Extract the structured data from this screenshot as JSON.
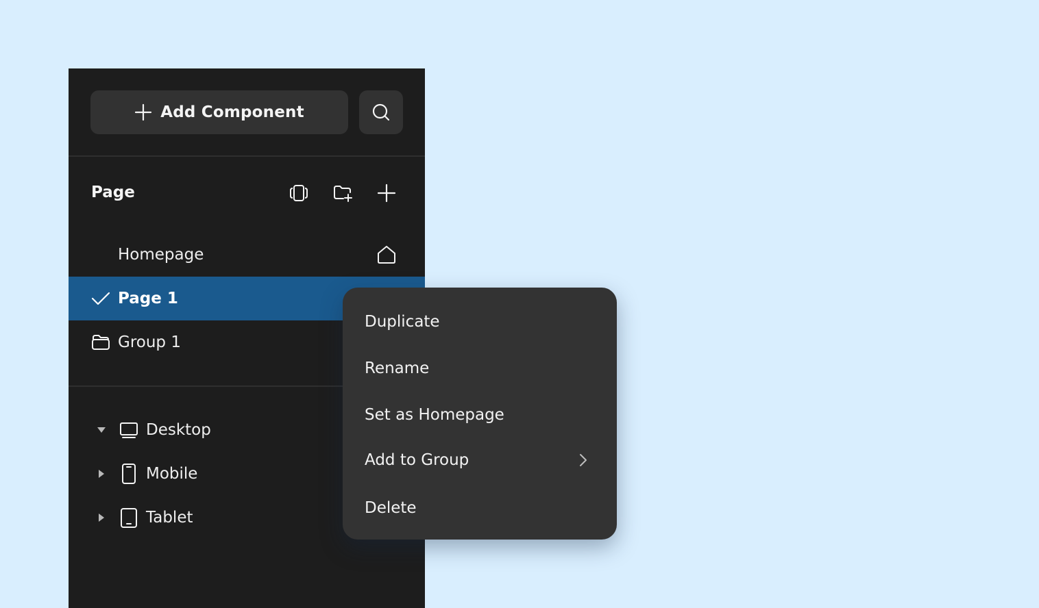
{
  "toolbar": {
    "add_component_label": "Add Component"
  },
  "pages": {
    "title": "Page",
    "items": [
      {
        "label": "Homepage",
        "icon": "home-icon"
      },
      {
        "label": "Page 1",
        "selected": true,
        "icon": "check-icon"
      },
      {
        "label": "Group 1",
        "icon": "folder-icon"
      }
    ]
  },
  "breakpoints": {
    "items": [
      {
        "label": "Desktop",
        "expanded": true,
        "icon": "desktop-icon"
      },
      {
        "label": "Mobile",
        "expanded": false,
        "icon": "mobile-icon"
      },
      {
        "label": "Tablet",
        "expanded": false,
        "icon": "tablet-icon"
      }
    ]
  },
  "context_menu": {
    "items": [
      {
        "label": "Duplicate"
      },
      {
        "label": "Rename"
      },
      {
        "label": "Set as Homepage"
      },
      {
        "label": "Add to Group",
        "has_submenu": true
      },
      {
        "label": "Delete"
      }
    ]
  },
  "colors": {
    "background": "#d9eefe",
    "panel": "#1d1d1d",
    "selected_row": "#1a5a8e",
    "menu": "#333333"
  }
}
